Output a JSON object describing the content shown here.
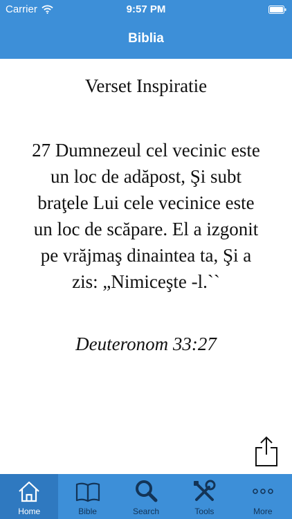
{
  "status_bar": {
    "carrier": "Carrier",
    "time": "9:57 PM"
  },
  "nav": {
    "title": "Biblia"
  },
  "content": {
    "heading": "Verset Inspiratie",
    "verse": "27 Dumnezeul cel vecinic este un loc de adăpost, Şi subt braţele Lui cele vecinice este un loc de scăpare. El a izgonit pe vrăjmaş dinaintea ta, Şi a zis: „Nimiceşte -l.``",
    "reference": "Deuteronom 33:27"
  },
  "tabs": [
    {
      "label": "Home",
      "icon": "home-icon",
      "active": true
    },
    {
      "label": "Bible",
      "icon": "book-icon",
      "active": false
    },
    {
      "label": "Search",
      "icon": "search-icon",
      "active": false
    },
    {
      "label": "Tools",
      "icon": "tools-icon",
      "active": false
    },
    {
      "label": "More",
      "icon": "more-icon",
      "active": false
    }
  ],
  "colors": {
    "bar": "#3d8fd8",
    "active_tab": "#2f79c0",
    "inactive_icon": "#133457",
    "text": "#111111"
  }
}
